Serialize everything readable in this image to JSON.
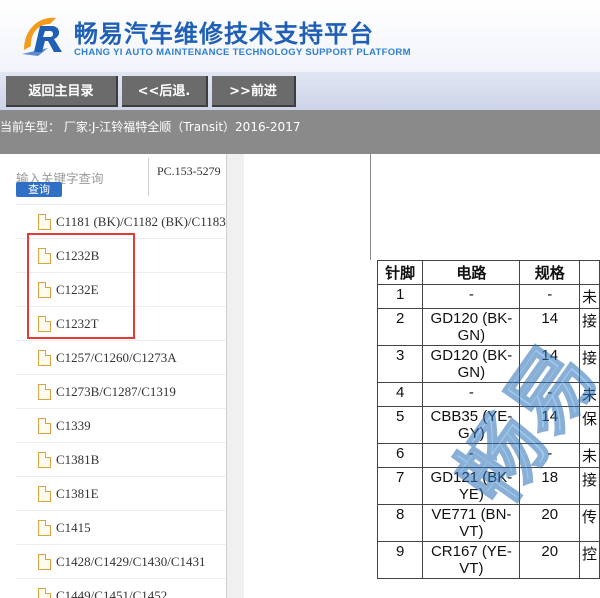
{
  "header": {
    "title": "畅易汽车维修技术支持平台",
    "subtitle": "CHANG YI AUTO MAINTENANCE TECHNOLOGY SUPPORT PLATFORM"
  },
  "nav": {
    "home": "返回主目录",
    "back": "<<后退.",
    "forward": ">>前进"
  },
  "info": {
    "current_model": "当前车型： 厂家:J-江铃福特全顺（Transit）2016-2017"
  },
  "sidebar": {
    "search_placeholder": "输入关键字查询",
    "search_button": "查询",
    "pc_code": "PC.153-5279",
    "items": [
      {
        "label": "C1181 (BK)/C1182 (BK)/C1183"
      },
      {
        "label": "C1232B"
      },
      {
        "label": "C1232E"
      },
      {
        "label": "C1232T"
      },
      {
        "label": "C1257/C1260/C1273A"
      },
      {
        "label": "C1273B/C1287/C1319"
      },
      {
        "label": "C1339"
      },
      {
        "label": "C1381B"
      },
      {
        "label": "C1381E"
      },
      {
        "label": "C1415"
      },
      {
        "label": "C1428/C1429/C1430/C1431"
      },
      {
        "label": "C1449/C1451/C1452"
      }
    ]
  },
  "pin_table": {
    "headers": [
      "针脚",
      "电路",
      "规格",
      ""
    ],
    "rows": [
      {
        "pin": "1",
        "circuit": "-",
        "spec": "-",
        "extra": "未"
      },
      {
        "pin": "2",
        "circuit": "GD120 (BK-GN)",
        "spec": "14",
        "extra": "接"
      },
      {
        "pin": "3",
        "circuit": "GD120 (BK-GN)",
        "spec": "14",
        "extra": "接"
      },
      {
        "pin": "4",
        "circuit": "-",
        "spec": "-",
        "extra": "未"
      },
      {
        "pin": "5",
        "circuit": "CBB35 (YE-GY)",
        "spec": "14",
        "extra": "保"
      },
      {
        "pin": "6",
        "circuit": "-",
        "spec": "-",
        "extra": "未"
      },
      {
        "pin": "7",
        "circuit": "GD121 (BK-YE)",
        "spec": "18",
        "extra": "接"
      },
      {
        "pin": "8",
        "circuit": "VE771 (BN-VT)",
        "spec": "20",
        "extra": "传"
      },
      {
        "pin": "9",
        "circuit": "CR167 (YE-VT)",
        "spec": "20",
        "extra": "控"
      }
    ]
  },
  "watermark": "畅易",
  "colors": {
    "brand_blue": "#1f5fb6",
    "nav_button": "#6b6b6b",
    "info_bar": "#8a8a8a",
    "search_button": "#2f6fc6",
    "highlight": "#e53935"
  }
}
